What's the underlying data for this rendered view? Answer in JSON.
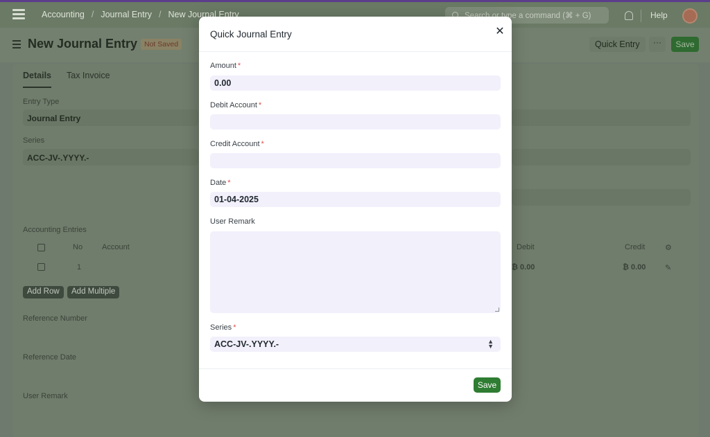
{
  "navbar": {
    "breadcrumbs": [
      "Accounting",
      "Journal Entry",
      "New Journal Entry"
    ],
    "search_placeholder": "Search or type a command (⌘ + G)",
    "help_label": "Help"
  },
  "page": {
    "title": "New Journal Entry",
    "status_badge": "Not Saved",
    "quick_entry_label": "Quick Entry",
    "more_label": "···",
    "save_label": "Save"
  },
  "form": {
    "tabs": [
      "Details",
      "Tax Invoice"
    ],
    "entry_type_label": "Entry Type",
    "entry_type_value": "Journal Entry",
    "series_label": "Series",
    "series_value": "ACC-JV-.YYYY.-",
    "accounting_entries_label": "Accounting Entries",
    "table_headers": {
      "no": "No",
      "account": "Account",
      "debit": "Debit",
      "credit": "Credit"
    },
    "row": {
      "no": "1",
      "debit": "₿ 0.00",
      "credit": "₿ 0.00"
    },
    "add_row_label": "Add Row",
    "add_multiple_label": "Add Multiple",
    "reference_number_label": "Reference Number",
    "reference_date_label": "Reference Date",
    "user_remark_label": "User Remark"
  },
  "modal": {
    "title": "Quick Journal Entry",
    "close_icon": "close-icon",
    "amount_label": "Amount",
    "amount_value": "0.00",
    "debit_account_label": "Debit Account",
    "debit_account_value": "",
    "credit_account_label": "Credit Account",
    "credit_account_value": "",
    "date_label": "Date",
    "date_value": "01-04-2025",
    "user_remark_label": "User Remark",
    "series_label": "Series",
    "series_value": "ACC-JV-.YYYY.-",
    "required_marker": "*",
    "save_label": "Save"
  },
  "colors": {
    "primary_button": "#2e7d32",
    "input_bg": "#f2f0fb",
    "required": "#e24c4c"
  }
}
